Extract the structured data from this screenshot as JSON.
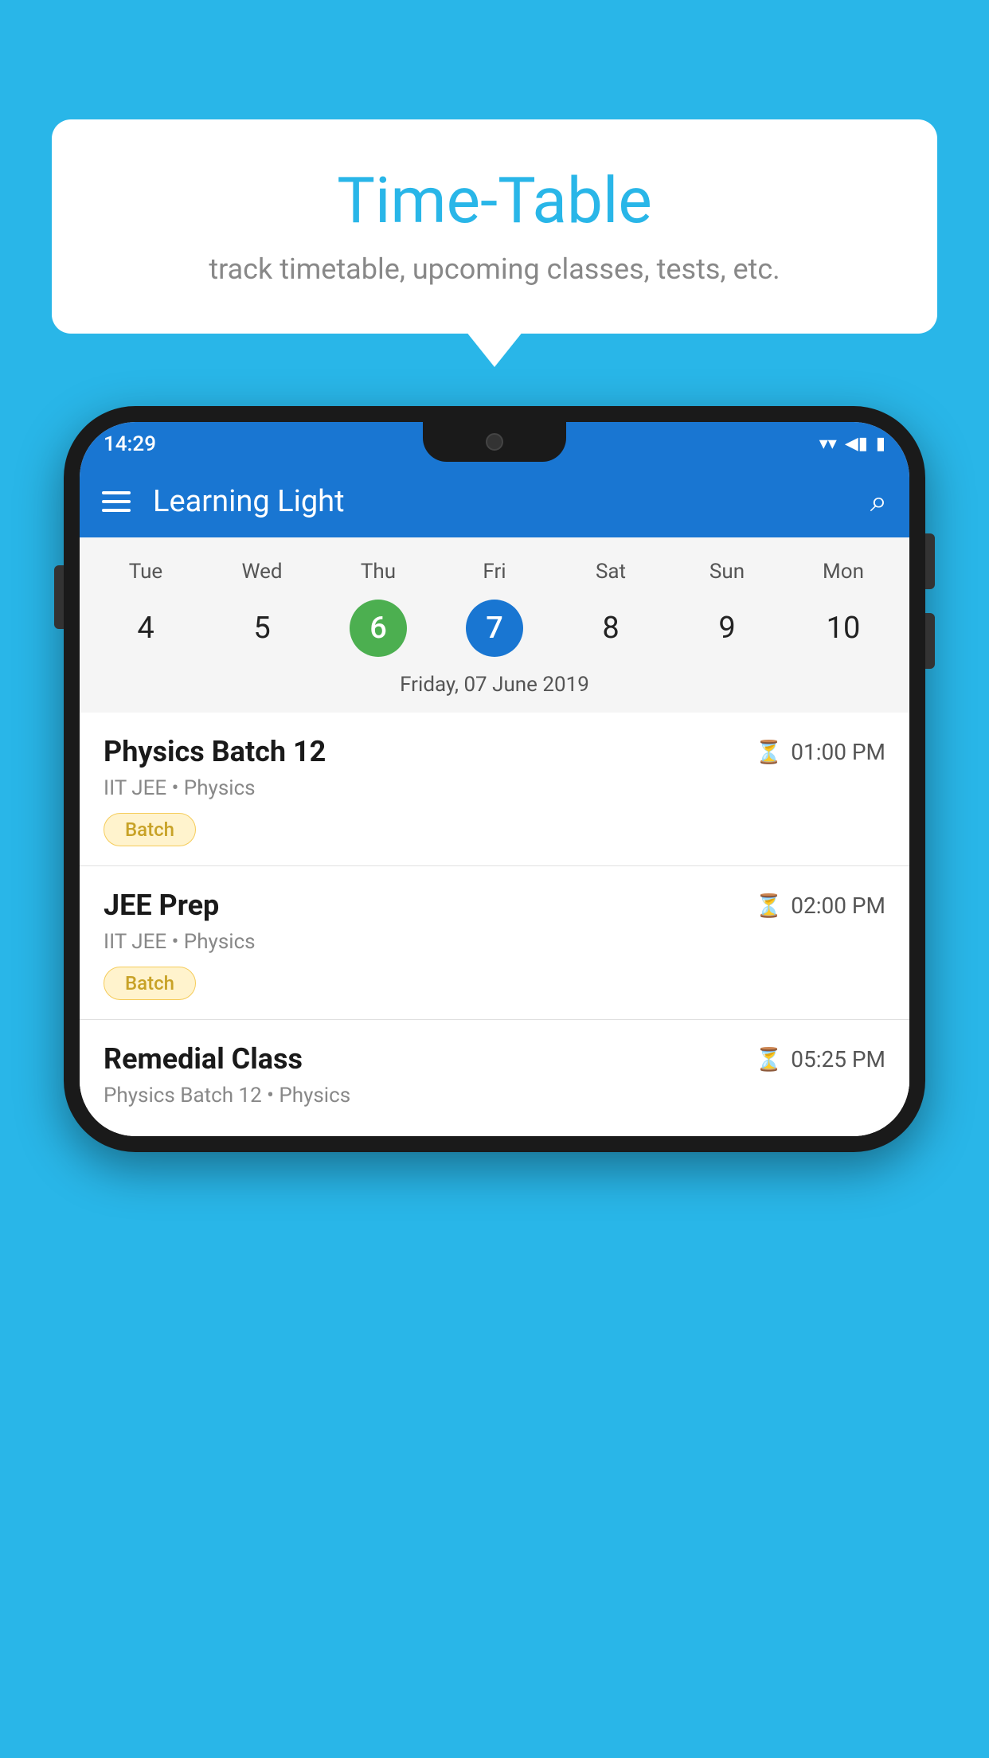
{
  "background_color": "#29b6e8",
  "speech_bubble": {
    "title": "Time-Table",
    "subtitle": "track timetable, upcoming classes, tests, etc."
  },
  "status_bar": {
    "time": "14:29",
    "wifi_icon": "▼",
    "signal_icon": "◄",
    "battery_icon": "▮"
  },
  "app_bar": {
    "title": "Learning Light",
    "hamburger_label": "menu",
    "search_label": "search"
  },
  "calendar": {
    "days": [
      "Tue",
      "Wed",
      "Thu",
      "Fri",
      "Sat",
      "Sun",
      "Mon"
    ],
    "dates": [
      "4",
      "5",
      "6",
      "7",
      "8",
      "9",
      "10"
    ],
    "today_index": 2,
    "selected_index": 3,
    "selected_date_label": "Friday, 07 June 2019"
  },
  "schedule": [
    {
      "title": "Physics Batch 12",
      "time": "01:00 PM",
      "subtitle": "IIT JEE • Physics",
      "badge": "Batch"
    },
    {
      "title": "JEE Prep",
      "time": "02:00 PM",
      "subtitle": "IIT JEE • Physics",
      "badge": "Batch"
    },
    {
      "title": "Remedial Class",
      "time": "05:25 PM",
      "subtitle": "Physics Batch 12 • Physics"
    }
  ]
}
